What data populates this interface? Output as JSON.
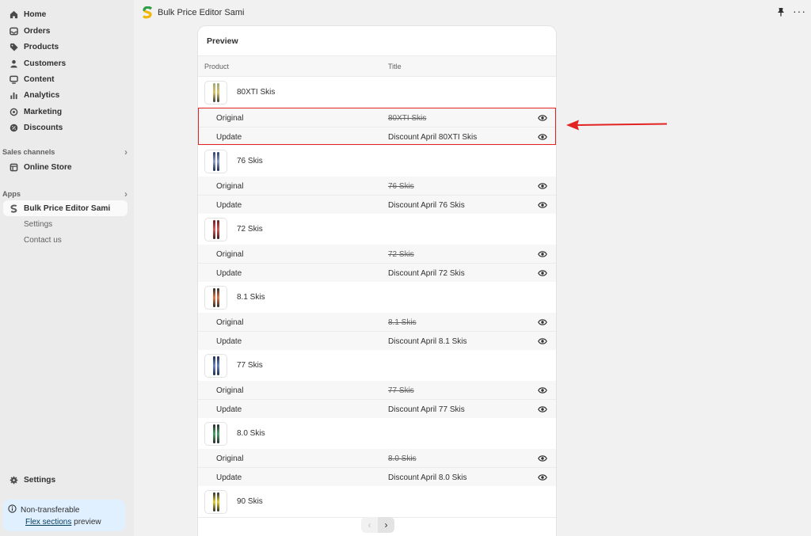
{
  "sidebar": {
    "nav": [
      {
        "label": "Home",
        "icon": "home-icon"
      },
      {
        "label": "Orders",
        "icon": "inbox-icon"
      },
      {
        "label": "Products",
        "icon": "tag-icon"
      },
      {
        "label": "Customers",
        "icon": "person-icon"
      },
      {
        "label": "Content",
        "icon": "monitor-icon"
      },
      {
        "label": "Analytics",
        "icon": "bar-chart-icon"
      },
      {
        "label": "Marketing",
        "icon": "target-icon"
      },
      {
        "label": "Discounts",
        "icon": "discount-icon"
      }
    ],
    "sales_channels": {
      "title": "Sales channels",
      "items": [
        {
          "label": "Online Store",
          "icon": "store-icon"
        }
      ]
    },
    "apps": {
      "title": "Apps",
      "app_label": "Bulk Price Editor Sami",
      "sub_items": [
        "Settings",
        "Contact us"
      ]
    },
    "settings_label": "Settings",
    "notice": {
      "line1": "Non-transferable",
      "link": "Flex sections",
      "suffix": "preview"
    }
  },
  "topbar": {
    "app_name": "Bulk Price Editor Sami",
    "more_label": "···"
  },
  "card": {
    "title": "Preview",
    "columns": {
      "product": "Product",
      "title": "Title"
    },
    "original_label": "Original",
    "update_label": "Update",
    "products": [
      {
        "name": "80XTI Skis",
        "original": "80XTI Skis",
        "update": "Discount April 80XTI Skis"
      },
      {
        "name": "76 Skis",
        "original": "76 Skis",
        "update": "Discount April 76 Skis"
      },
      {
        "name": "72 Skis",
        "original": "72 Skis",
        "update": "Discount April 72 Skis"
      },
      {
        "name": "8.1 Skis",
        "original": "8.1 Skis",
        "update": "Discount April 8.1 Skis"
      },
      {
        "name": "77 Skis",
        "original": "77 Skis",
        "update": "Discount April 77 Skis"
      },
      {
        "name": "8.0 Skis",
        "original": "8.0 Skis",
        "update": "Discount April 8.0 Skis"
      },
      {
        "name": "90 Skis"
      }
    ],
    "pager": {
      "prev": "‹",
      "next": "›"
    }
  },
  "colors": {
    "highlight": "#e32222",
    "notice_bg": "#e0f0ff",
    "sidebar_bg": "#ebebeb"
  }
}
